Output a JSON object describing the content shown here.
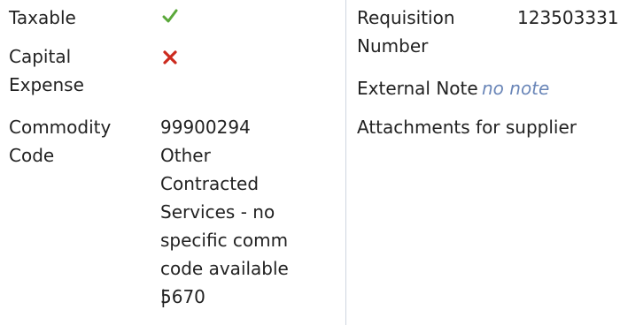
{
  "details": {
    "taxable": {
      "label": "Taxable",
      "icon": "green-checkmark-icon",
      "color": "#5aa83a"
    },
    "capital_expense": {
      "label_line1": "Capital",
      "label_line2": "Expense",
      "icon": "red-x-icon",
      "color": "#cc2a1e"
    },
    "commodity_code": {
      "label_line1": "Commodity",
      "label_line2": "Code",
      "value_lines": [
        "99900294",
        "Other",
        "Contracted",
        "Services - no",
        "specific comm",
        "code available |",
        "5670"
      ]
    }
  },
  "right": {
    "requisition_number": {
      "label_line1": "Requisition",
      "label_line2": "Number",
      "value": "123503331"
    },
    "external_note": {
      "label": "External Note",
      "value": "no note",
      "value_color": "#6a86b8"
    },
    "attachments": {
      "label": "Attachments for supplier"
    }
  },
  "colors": {
    "text": "#222222",
    "divider": "#cfd6e0"
  }
}
